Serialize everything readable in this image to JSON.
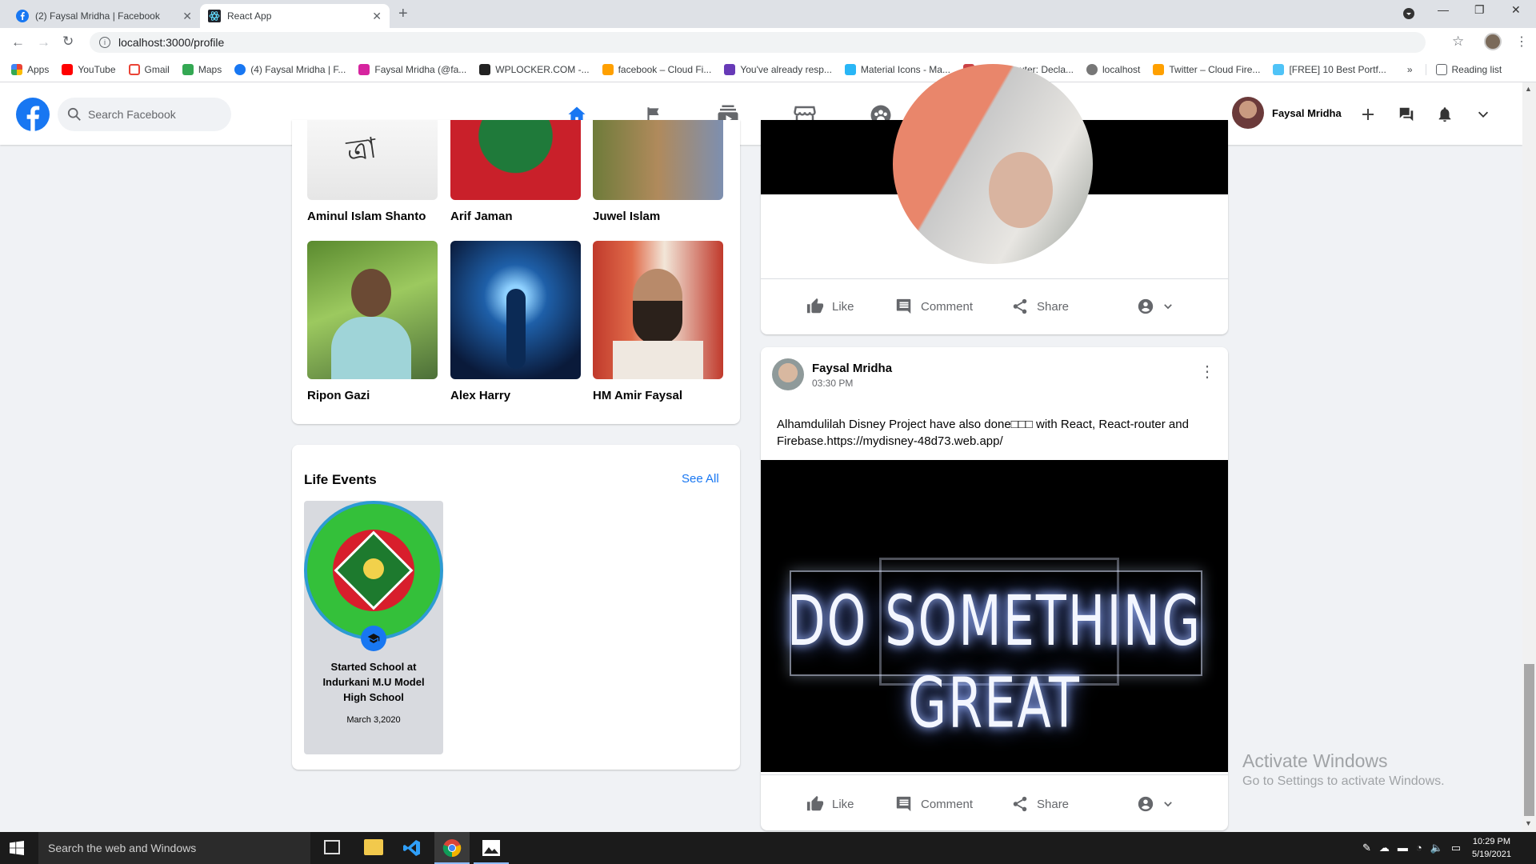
{
  "browser": {
    "tabs": [
      {
        "title": "(2) Faysal Mridha | Facebook",
        "active": false
      },
      {
        "title": "React App",
        "active": true
      }
    ],
    "url": "localhost:3000/profile",
    "bookmarks": [
      "Apps",
      "YouTube",
      "Gmail",
      "Maps",
      "(4) Faysal Mridha | F...",
      "Faysal Mridha (@fa...",
      "WPLOCKER.COM -...",
      "facebook – Cloud Fi...",
      "You've already resp...",
      "Material Icons - Ma...",
      "React Router: Decla...",
      "localhost",
      "Twitter – Cloud Fire...",
      "[FREE] 10 Best Portf..."
    ],
    "more_bookmarks": "»",
    "reading_list": "Reading list"
  },
  "header": {
    "search_placeholder": "Search Facebook",
    "profile_name": "Faysal Mridha",
    "nav": [
      "home",
      "pages",
      "watch",
      "marketplace",
      "groups"
    ]
  },
  "friends": [
    {
      "name": "Aminul Islam Shanto"
    },
    {
      "name": "Arif Jaman"
    },
    {
      "name": "Juwel Islam"
    },
    {
      "name": "Ripon Gazi"
    },
    {
      "name": "Alex Harry"
    },
    {
      "name": "HM Amir Faysal"
    }
  ],
  "life_events": {
    "title": "Life Events",
    "see_all": "See All",
    "event": {
      "title": "Started School at Indurkani M.U Model High School",
      "date": "March 3,2020"
    }
  },
  "post_actions": {
    "like": "Like",
    "comment": "Comment",
    "share": "Share"
  },
  "post": {
    "author": "Faysal Mridha",
    "time": "03:30 PM",
    "text": "Alhamdulilah Disney Project have also done□□□ with React, React-router and Firebase.https://mydisney-48d73.web.app/",
    "image_text": "DO SOMETHING GREAT"
  },
  "watermark": {
    "line1": "Activate Windows",
    "line2": "Go to Settings to activate Windows."
  },
  "taskbar": {
    "search": "Search the web and Windows",
    "time": "10:29 PM",
    "date": "5/19/2021"
  }
}
